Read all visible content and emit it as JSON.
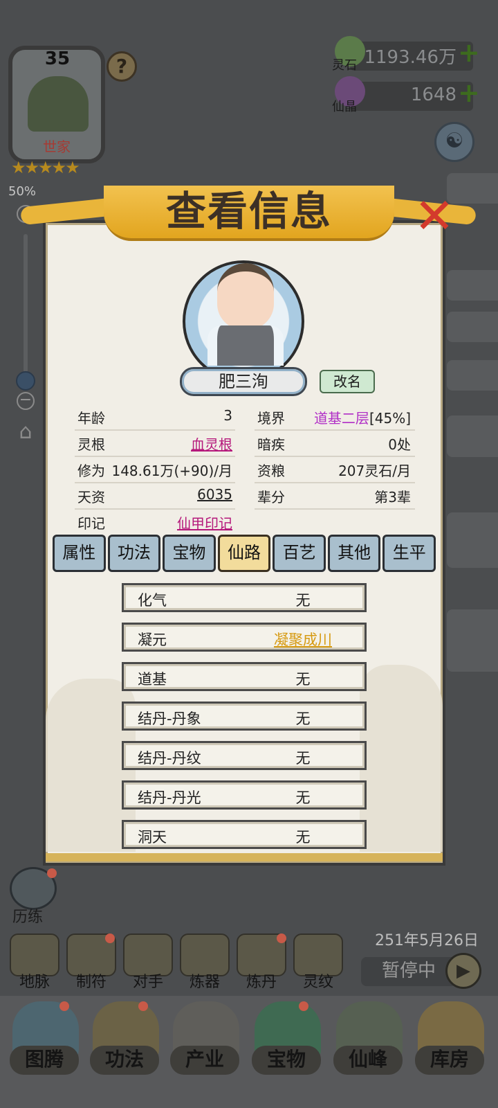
{
  "family": {
    "level": "35",
    "name": "世家",
    "stars": "★★★★★",
    "help": "?"
  },
  "zoom": {
    "percent": "50%",
    "plus": "+",
    "minus": "−",
    "level_value": 0.5
  },
  "currencies": [
    {
      "label": "灵石",
      "value": "1193.46万",
      "plus": "+",
      "icon": "spirit-stone-icon",
      "color": "#5b7b4a"
    },
    {
      "label": "仙晶",
      "value": "1648",
      "plus": "+",
      "icon": "immortal-crystal-icon",
      "color": "#6b4a78"
    }
  ],
  "dialog": {
    "title": "查看信息",
    "close": "✕",
    "name": "肥三洵",
    "rename": "改名",
    "info": {
      "left": [
        {
          "label": "年龄",
          "value": "3"
        },
        {
          "label": "灵根",
          "value": "血灵根"
        },
        {
          "label": "修为",
          "value": "148.61万(+90)/月"
        },
        {
          "label": "天资",
          "value": "6035"
        },
        {
          "label": "印记",
          "value": "仙甲印记"
        }
      ],
      "right": [
        {
          "label": "境界",
          "value": "道基二层",
          "extra": "[45%]"
        },
        {
          "label": "暗疾",
          "value": "0处"
        },
        {
          "label": "资粮",
          "value": "207灵石/月"
        },
        {
          "label": "辈分",
          "value": "第3辈"
        }
      ]
    },
    "tabs": [
      "属性",
      "功法",
      "宝物",
      "仙路",
      "百艺",
      "其他",
      "生平"
    ],
    "active_tab": "仙路",
    "path": [
      {
        "name": "化气",
        "value": "无"
      },
      {
        "name": "凝元",
        "value": "凝聚成川"
      },
      {
        "name": "道基",
        "value": "无"
      },
      {
        "name": "结丹-丹象",
        "value": "无"
      },
      {
        "name": "结丹-丹纹",
        "value": "无"
      },
      {
        "name": "结丹-丹光",
        "value": "无"
      },
      {
        "name": "洞天",
        "value": "无"
      }
    ]
  },
  "hud": {
    "lilian": "历练",
    "date": "251年5月26日",
    "pause": "暂停中",
    "play": "▶",
    "mid_buttons": [
      "地脉",
      "制符",
      "对手",
      "炼器",
      "炼丹",
      "灵纹"
    ],
    "nav": [
      "图腾",
      "功法",
      "产业",
      "宝物",
      "仙峰",
      "库房"
    ]
  },
  "colors": {
    "accent_gold": "#e9b53a",
    "link_magenta": "#b5187b",
    "realm_purple": "#b02ec6",
    "path_gold": "#d69a12",
    "close_red": "#d33a2c"
  }
}
